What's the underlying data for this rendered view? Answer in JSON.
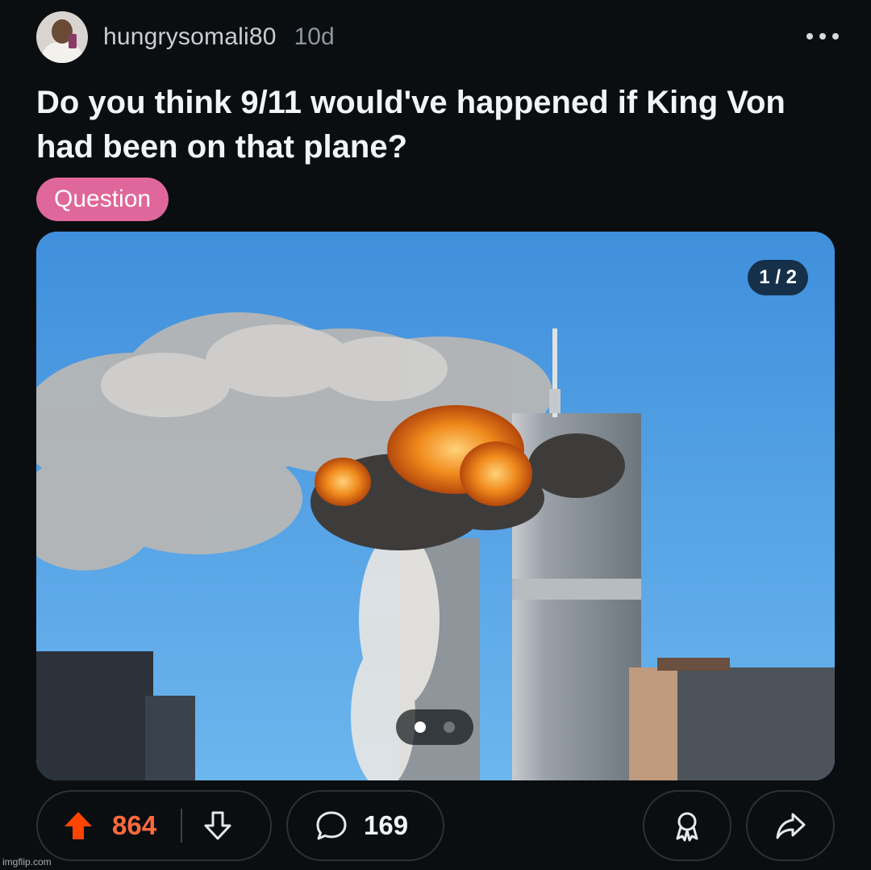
{
  "post": {
    "username": "hungrysomali80",
    "age": "10d",
    "title": "Do you think 9/11 would've happened if King Von had been on that plane?",
    "flair": "Question",
    "flair_color": "#e0679b"
  },
  "media": {
    "counter": "1 / 2",
    "current_slide": 1,
    "total_slides": 2
  },
  "actions": {
    "score": "864",
    "comments": "169",
    "upvoted": true,
    "upvote_color": "#ff4500"
  },
  "watermark": "imgflip.com",
  "colors": {
    "background": "#0b0e11",
    "score_text": "#ff6b3d",
    "pill_border": "#2b3136"
  },
  "icons": [
    "more-options-icon",
    "upvote-arrow-icon",
    "downvote-arrow-icon",
    "comment-bubble-icon",
    "award-icon",
    "share-icon"
  ]
}
